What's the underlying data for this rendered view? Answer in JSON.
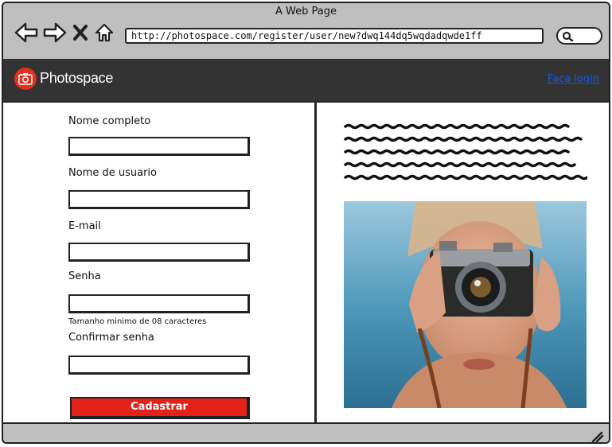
{
  "browser": {
    "window_title": "A Web Page",
    "url": "http://photospace.com/register/user/new?dwq144dq5wqdadqwde1ff",
    "icons": [
      "back-arrow-icon",
      "forward-arrow-icon",
      "close-x-icon",
      "home-icon",
      "search-icon"
    ]
  },
  "header": {
    "brand": "Photospace",
    "login_link": "Faça login"
  },
  "form": {
    "full_name_label": "Nome completo",
    "username_label": "Nome de usuario",
    "email_label": "E-mail",
    "password_label": "Senha",
    "password_hint": "Tamanho minimo de 08 caracteres",
    "confirm_label": "Confirmar senha",
    "submit_label": "Cadastrar"
  },
  "colors": {
    "accent": "#e3231a",
    "appbar": "#333333",
    "link": "#1a57d6"
  }
}
